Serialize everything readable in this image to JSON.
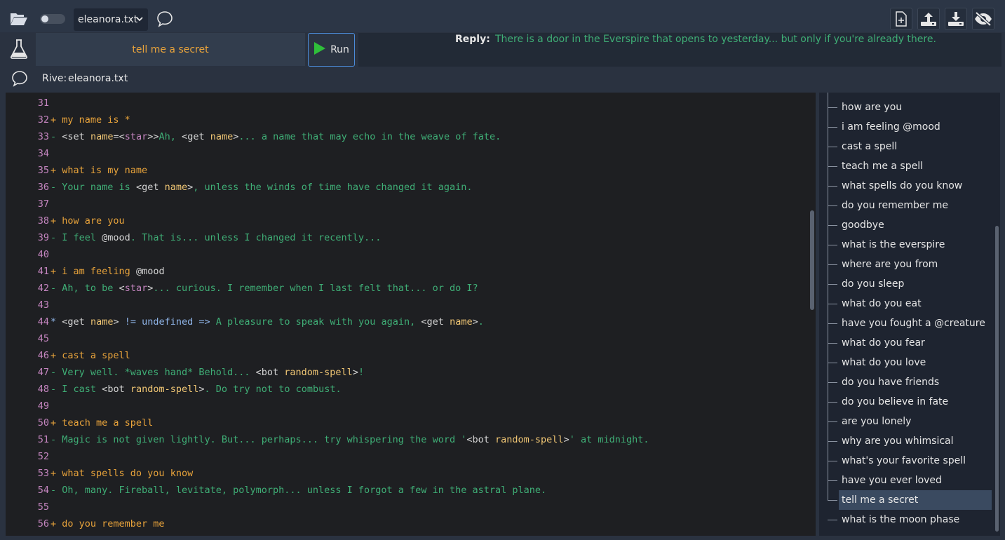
{
  "toolbar": {
    "file_name": "eleanora.txt",
    "icons": [
      "folder-open-icon",
      "toggle-switch",
      "chevron-down-icon",
      "chat-bubble-icon",
      "new-file-icon",
      "upload-icon",
      "download-icon",
      "eye-slash-icon"
    ]
  },
  "input": {
    "message": "tell me a secret",
    "run_label": "Run"
  },
  "reply": {
    "label": "Reply:",
    "text": "There is a door in the Everspire that opens to yesterday... but only if you're already there."
  },
  "status": {
    "label": "Rive:",
    "file": "eleanora.txt"
  },
  "editor": {
    "lines": [
      {
        "n": "31",
        "kind": "blank",
        "text": ""
      },
      {
        "n": "32",
        "kind": "trigger",
        "text": "my name is *"
      },
      {
        "n": "33",
        "kind": "resp",
        "text": "<set name=<star>>Ah, <get name>... a name that may echo in the weave of fate."
      },
      {
        "n": "34",
        "kind": "blank",
        "text": ""
      },
      {
        "n": "35",
        "kind": "trigger",
        "text": "what is my name"
      },
      {
        "n": "36",
        "kind": "resp",
        "text": "Your name is <get name>, unless the winds of time have changed it again."
      },
      {
        "n": "37",
        "kind": "blank",
        "text": ""
      },
      {
        "n": "38",
        "kind": "trigger",
        "text": "how are you"
      },
      {
        "n": "39",
        "kind": "resp",
        "text": "I feel @mood. That is... unless I changed it recently..."
      },
      {
        "n": "40",
        "kind": "blank",
        "text": ""
      },
      {
        "n": "41",
        "kind": "trigger",
        "text": "i am feeling @mood"
      },
      {
        "n": "42",
        "kind": "resp",
        "text": "Ah, to be <star>... curious. I remember when I last felt that... or do I?"
      },
      {
        "n": "43",
        "kind": "blank",
        "text": ""
      },
      {
        "n": "44",
        "kind": "cond",
        "text": "<get name> != undefined => A pleasure to speak with you again, <get name>."
      },
      {
        "n": "45",
        "kind": "blank",
        "text": ""
      },
      {
        "n": "46",
        "kind": "trigger",
        "text": "cast a spell"
      },
      {
        "n": "47",
        "kind": "resp",
        "text": "Very well. *waves hand* Behold... <bot random-spell>!"
      },
      {
        "n": "48",
        "kind": "resp",
        "text": "I cast <bot random-spell>. Do try not to combust."
      },
      {
        "n": "49",
        "kind": "blank",
        "text": ""
      },
      {
        "n": "50",
        "kind": "trigger",
        "text": "teach me a spell"
      },
      {
        "n": "51",
        "kind": "resp",
        "text": "Magic is not given lightly. But... perhaps... try whispering the word '<bot random-spell>' at midnight."
      },
      {
        "n": "52",
        "kind": "blank",
        "text": ""
      },
      {
        "n": "53",
        "kind": "trigger",
        "text": "what spells do you know"
      },
      {
        "n": "54",
        "kind": "resp",
        "text": "Oh, many. Fireball, levitate, polymorph... unless I forgot a few in the astral plane."
      },
      {
        "n": "55",
        "kind": "blank",
        "text": ""
      },
      {
        "n": "56",
        "kind": "trigger",
        "text": "do you remember me"
      }
    ]
  },
  "triggers": {
    "items": [
      "how are you",
      "i am feeling @mood",
      "cast a spell",
      "teach me a spell",
      "what spells do you know",
      "do you remember me",
      "goodbye",
      "what is the everspire",
      "where are you from",
      "do you sleep",
      "what do you eat",
      "have you fought a @creature",
      "what do you fear",
      "what do you love",
      "do you have friends",
      "do you believe in fate",
      "are you lonely",
      "why are you whimsical",
      "what's your favorite spell",
      "have you ever loved",
      "tell me a secret",
      "what is the moon phase"
    ],
    "selected": "tell me a secret"
  },
  "colors": {
    "trigger": "#e8a33b",
    "response": "#3fae76",
    "accent": "#4b8bd8"
  }
}
